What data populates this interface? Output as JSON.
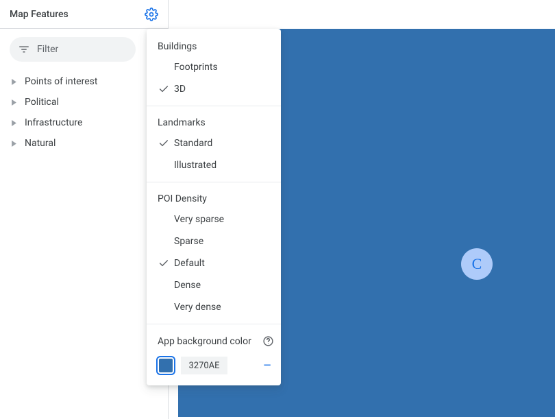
{
  "sidebar": {
    "title": "Map Features",
    "filter_placeholder": "Filter",
    "features": [
      {
        "label": "Points of interest"
      },
      {
        "label": "Political"
      },
      {
        "label": "Infrastructure"
      },
      {
        "label": "Natural"
      }
    ]
  },
  "settings_menu": {
    "buildings": {
      "header": "Buildings",
      "options": [
        {
          "label": "Footprints",
          "selected": false
        },
        {
          "label": "3D",
          "selected": true
        }
      ]
    },
    "landmarks": {
      "header": "Landmarks",
      "options": [
        {
          "label": "Standard",
          "selected": true
        },
        {
          "label": "Illustrated",
          "selected": false
        }
      ]
    },
    "poi_density": {
      "header": "POI Density",
      "options": [
        {
          "label": "Very sparse",
          "selected": false
        },
        {
          "label": "Sparse",
          "selected": false
        },
        {
          "label": "Default",
          "selected": true
        },
        {
          "label": "Dense",
          "selected": false
        },
        {
          "label": "Very dense",
          "selected": false
        }
      ]
    },
    "app_background": {
      "label": "App background color",
      "hex": "3270AE",
      "minus": "—"
    }
  },
  "map": {
    "badge_letter": "C",
    "background_color": "#3270AE"
  }
}
